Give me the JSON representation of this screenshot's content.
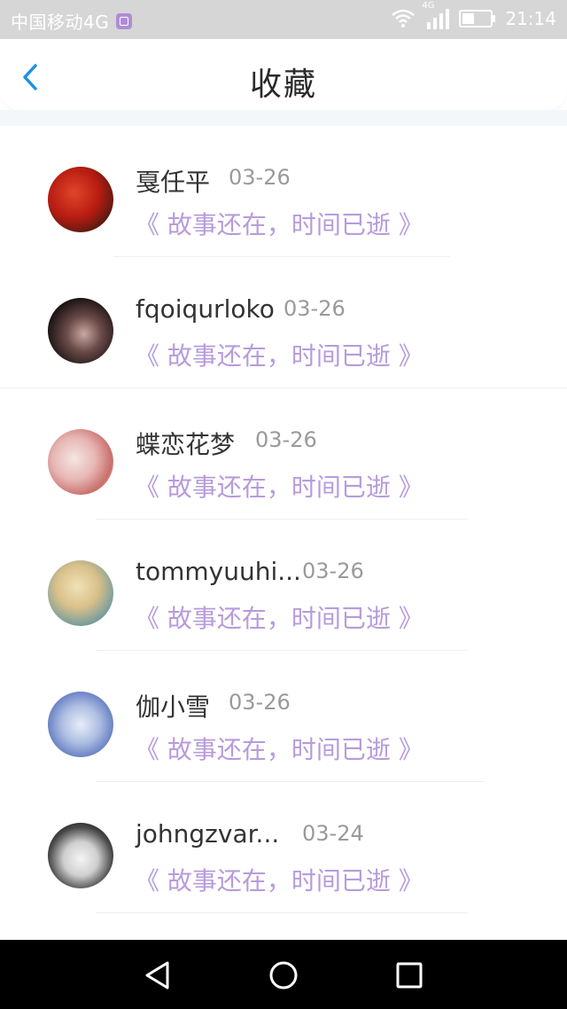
{
  "status_bar": {
    "carrier": "中国移动4G",
    "network_badge": "4G",
    "time": "21:14",
    "icons": [
      "app-notification-icon",
      "wifi-icon",
      "signal-icon",
      "battery-icon"
    ]
  },
  "header": {
    "title": "收藏",
    "back_icon": "chevron-left-icon",
    "accent": "#1e8fe8"
  },
  "colors": {
    "work_title": "#b79bdc",
    "date": "#9a9a9a",
    "name": "#333333"
  },
  "favorites": [
    {
      "name": "戛任平",
      "date": "03-26",
      "title": "《 故事还在，时间已逝 》"
    },
    {
      "name": "fqoiqurloko",
      "date": "03-26",
      "title": "《 故事还在，时间已逝 》"
    },
    {
      "name": "蝶恋花梦",
      "date": "03-26",
      "title": "《 故事还在，时间已逝 》"
    },
    {
      "name": "tommyuuhi...",
      "date": "03-26",
      "title": "《 故事还在，时间已逝 》"
    },
    {
      "name": "伽小雪",
      "date": "03-26",
      "title": "《 故事还在，时间已逝 》"
    },
    {
      "name": "johngzvar...",
      "date": "03-24",
      "title": "《 故事还在，时间已逝 》"
    }
  ],
  "nav_bar": {
    "icons": [
      "back-triangle-icon",
      "home-circle-icon",
      "recents-square-icon"
    ]
  }
}
